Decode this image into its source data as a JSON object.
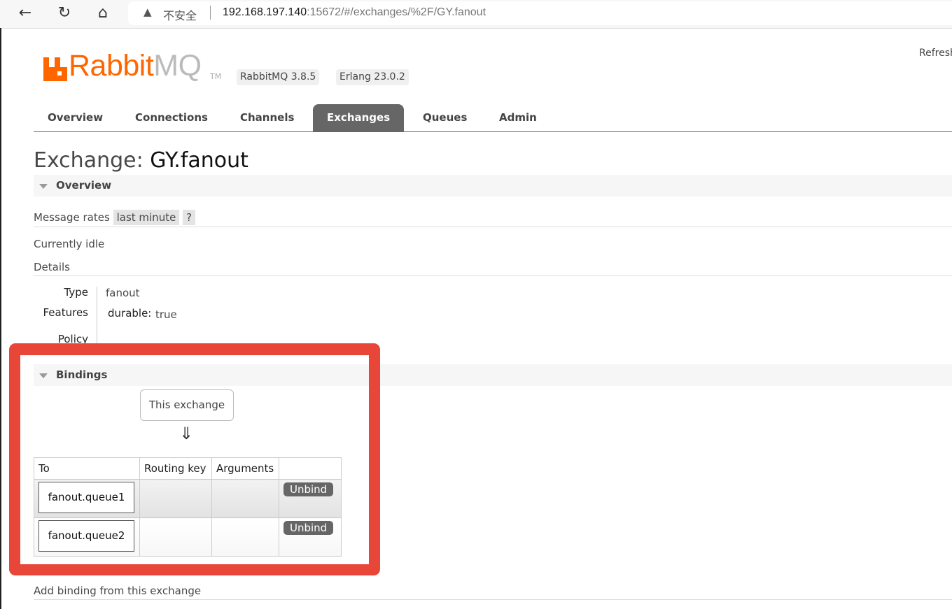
{
  "browser": {
    "insecure_label": "不安全",
    "url_host": "192.168.197.140",
    "url_rest": ":15672/#/exchanges/%2F/GY.fanout"
  },
  "header": {
    "logo_rabbit": "Rabbit",
    "logo_mq": "MQ",
    "logo_tm": "TM",
    "version_badge": "RabbitMQ 3.8.5",
    "erlang_badge": "Erlang 23.0.2",
    "refresh_label": "Refresh",
    "brand_color": "#f60"
  },
  "tabs": [
    {
      "label": "Overview"
    },
    {
      "label": "Connections"
    },
    {
      "label": "Channels"
    },
    {
      "label": "Exchanges",
      "active": true
    },
    {
      "label": "Queues"
    },
    {
      "label": "Admin"
    }
  ],
  "page": {
    "title_prefix": "Exchange:",
    "title_name": "GY.fanout"
  },
  "overview": {
    "heading": "Overview",
    "message_rates_label": "Message rates",
    "rate_period": "last minute",
    "help": "?",
    "idle": "Currently idle",
    "details_label": "Details",
    "details": {
      "type_label": "Type",
      "type_value": "fanout",
      "features_label": "Features",
      "durable_key": "durable:",
      "durable_value": "true",
      "policy_label": "Policy"
    }
  },
  "bindings": {
    "heading": "Bindings",
    "this_exchange": "This exchange",
    "arrow": "⇓",
    "columns": [
      "To",
      "Routing key",
      "Arguments",
      ""
    ],
    "rows": [
      {
        "to": "fanout.queue1",
        "routing_key": "",
        "arguments": "",
        "action": "Unbind"
      },
      {
        "to": "fanout.queue2",
        "routing_key": "",
        "arguments": "",
        "action": "Unbind"
      }
    ],
    "highlight_color": "#e84638"
  },
  "add_binding": "Add binding from this exchange"
}
